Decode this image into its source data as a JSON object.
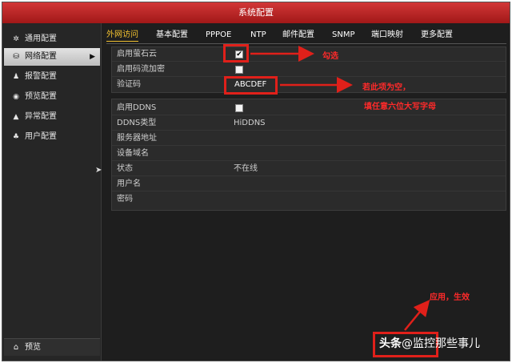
{
  "window": {
    "title": "系统配置"
  },
  "sidebar": {
    "items": [
      {
        "label": "通用配置",
        "icon": "gear-icon",
        "glyph": "✲"
      },
      {
        "label": "网络配置",
        "icon": "network-icon",
        "glyph": "⛁",
        "active": true,
        "arrow": "▶"
      },
      {
        "label": "报警配置",
        "icon": "alarm-icon",
        "glyph": "♟"
      },
      {
        "label": "预览配置",
        "icon": "eye-icon",
        "glyph": "◉"
      },
      {
        "label": "异常配置",
        "icon": "warning-icon",
        "glyph": "▲"
      },
      {
        "label": "用户配置",
        "icon": "users-icon",
        "glyph": "♣"
      }
    ],
    "preview": {
      "label": "预览",
      "icon": "home-icon",
      "glyph": "⌂"
    }
  },
  "tabs": [
    "外网访问",
    "基本配置",
    "PPPOE",
    "NTP",
    "邮件配置",
    "SNMP",
    "端口映射",
    "更多配置"
  ],
  "active_tab": "外网访问",
  "panel1": {
    "enable_cloud": {
      "label": "启用萤石云",
      "checked": true,
      "mark": "✔"
    },
    "stream_encrypt": {
      "label": "启用码流加密",
      "checked": false
    },
    "verify_code": {
      "label": "验证码",
      "value": "ABCDEF"
    }
  },
  "panel2": {
    "enable_ddns": {
      "label": "启用DDNS",
      "checked": false
    },
    "ddns_type": {
      "label": "DDNS类型",
      "value": "HiDDNS"
    },
    "server_addr": {
      "label": "服务器地址",
      "value": ""
    },
    "domain": {
      "label": "设备域名",
      "value": ""
    },
    "status": {
      "label": "状态",
      "value": "不在线"
    },
    "username": {
      "label": "用户名",
      "value": ""
    },
    "password": {
      "label": "密码",
      "value": ""
    }
  },
  "annotations": {
    "check_note": "勾选",
    "code_note_line1": "若此项为空，",
    "code_note_line2": "填任意六位大写字母",
    "apply_note": "应用，生效",
    "color": "#e0201a"
  },
  "watermark": {
    "brand": "头条",
    "handle": "@监控那些事儿"
  }
}
